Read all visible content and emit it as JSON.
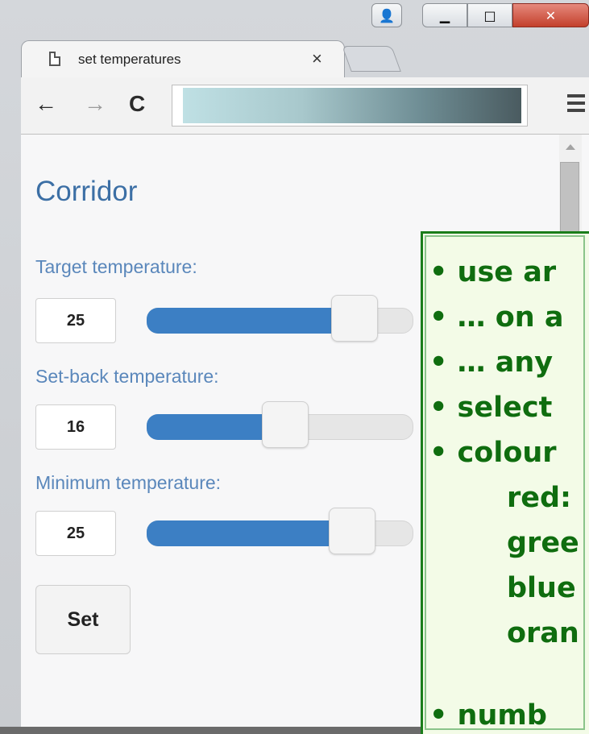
{
  "tab": {
    "title": "set temperatures",
    "close": "×"
  },
  "toolbar": {
    "back": "←",
    "forward": "→",
    "reload": "C"
  },
  "page": {
    "heading": "Corridor",
    "fields": [
      {
        "label": "Target temperature:",
        "value": "25",
        "level_fraction": 0.78
      },
      {
        "label": "Set-back temperature:",
        "value": "16",
        "level_fraction": 0.52
      },
      {
        "label": "Minimum temperature:",
        "value": "25",
        "level_fraction": 0.77
      }
    ],
    "set_label": "Set"
  },
  "overlay": {
    "lines": [
      "• use ar",
      "• … on a",
      "• … any",
      "• select",
      "• colour",
      "red:",
      "gree",
      "blue",
      "oran",
      "• numb"
    ]
  },
  "colors": {
    "accent": "#3c7fc4",
    "heading": "#3c6fa5",
    "label": "#5a87bb",
    "overlay_text": "#0f6d0f",
    "overlay_border": "#1a7d1a"
  }
}
